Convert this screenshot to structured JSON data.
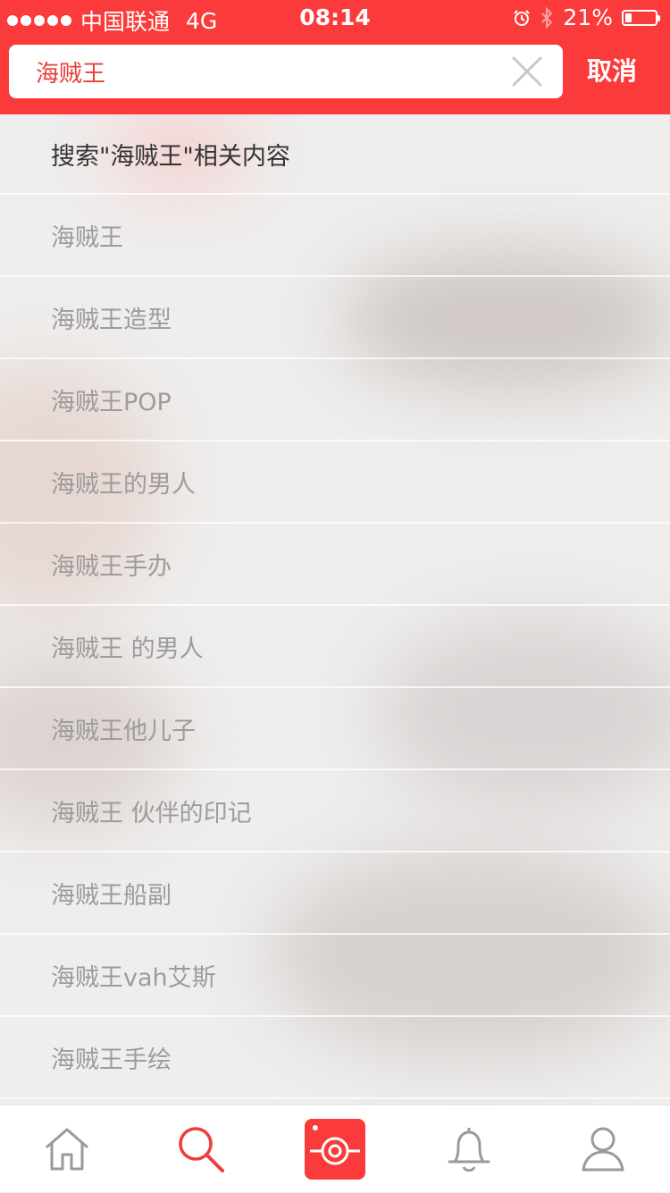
{
  "status_bar": {
    "carrier": "中国联通",
    "network": "4G",
    "time": "08:14",
    "battery_percent_text": "21%",
    "battery_level": 0.21,
    "icons": [
      "signal-dots-icon",
      "alarm-icon",
      "bluetooth-icon",
      "battery-icon"
    ]
  },
  "search": {
    "value": "海贼王",
    "clear_icon": "close-icon",
    "cancel_label": "取消"
  },
  "suggestions": {
    "header": "搜索\"海贼王\"相关内容",
    "items": [
      "海贼王",
      "海贼王造型",
      "海贼王POP",
      "海贼王的男人",
      "海贼王手办",
      "海贼王 的男人",
      "海贼王他儿子",
      "海贼王 伙伴的印记",
      "海贼王船副",
      "海贼王vah艾斯",
      "海贼王手绘"
    ]
  },
  "tab_bar": {
    "tabs": [
      {
        "icon": "home-icon",
        "active": false
      },
      {
        "icon": "search-icon",
        "active": true
      },
      {
        "icon": "camera-icon",
        "active": false
      },
      {
        "icon": "bell-icon",
        "active": false
      },
      {
        "icon": "user-icon",
        "active": false
      }
    ]
  },
  "colors": {
    "brand_red": "#fb3b3b",
    "search_text": "#e8403a",
    "suggestion_text": "#9d9b9b",
    "header_text": "#333333"
  }
}
